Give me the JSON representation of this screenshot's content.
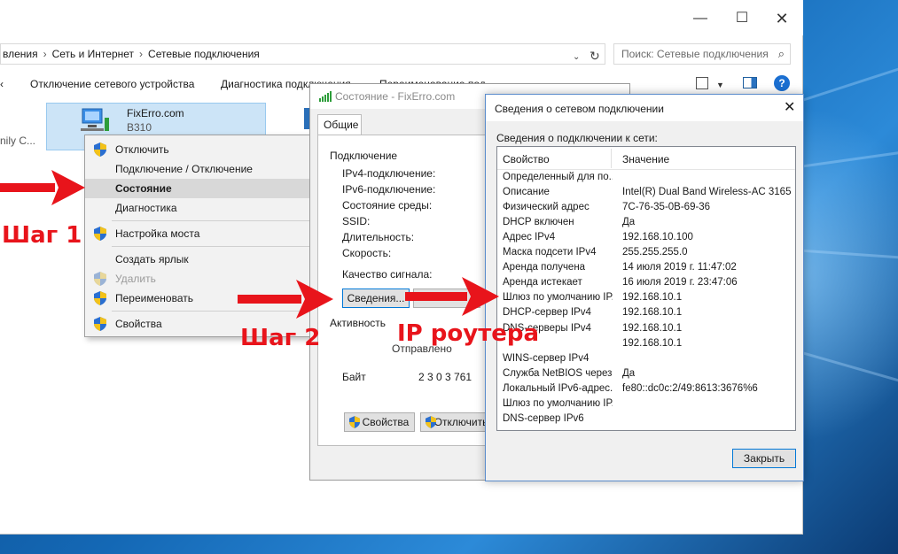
{
  "explorer": {
    "breadcrumb": [
      "вления",
      "Сеть и Интернет",
      "Сетевые подключения"
    ],
    "search_placeholder": "Поиск: Сетевые подключения",
    "commands": [
      "Отключение сетевого устройства",
      "Диагностика подключения",
      "Переименование подключения"
    ],
    "left_cut_text": "nily C...",
    "connection": {
      "name": "FixErro.com",
      "sub": "B310"
    }
  },
  "context_menu": {
    "items": [
      {
        "label": "Отключить",
        "shield": true
      },
      {
        "label": "Подключение / Отключение",
        "shield": false
      },
      {
        "label": "Состояние",
        "shield": false,
        "highlighted": true
      },
      {
        "label": "Диагностика",
        "shield": false
      },
      {
        "label": "Настройка моста",
        "shield": true
      },
      {
        "label": "Создать ярлык",
        "shield": false
      },
      {
        "label": "Удалить",
        "shield": true,
        "disabled": true
      },
      {
        "label": "Переименовать",
        "shield": true
      },
      {
        "label": "Свойства",
        "shield": true
      }
    ]
  },
  "annotations": {
    "step1": "Шаг 1",
    "step2": "Шаг 2",
    "router_ip": "IP роутера",
    "color": "#e8141b"
  },
  "status_dialog": {
    "title": "Состояние - FixErro.com",
    "tab": "Общие",
    "section_connection": "Подключение",
    "rows": [
      "IPv4-подключение:",
      "IPv6-подключение:",
      "Состояние среды:",
      "SSID:",
      "Длительность:",
      "Скорость:"
    ],
    "signal_quality": "Качество сигнала:",
    "details_button": "Сведения...",
    "section_activity": "Активность",
    "sent_label": "Отправлено",
    "bytes_label": "Байт",
    "bytes_value": "2 3 0 3 761",
    "properties_button": "Свойства",
    "disable_button": "Отключить"
  },
  "details_dialog": {
    "title": "Сведения о сетевом подключении",
    "subtitle": "Сведения о подключении к сети:",
    "col_property": "Свойство",
    "col_value": "Значение",
    "rows": [
      {
        "prop": "Определенный для по...",
        "val": ""
      },
      {
        "prop": "Описание",
        "val": "Intel(R) Dual Band Wireless-AC 3165"
      },
      {
        "prop": "Физический адрес",
        "val": "7C-76-35-0B-69-36"
      },
      {
        "prop": "DHCP включен",
        "val": "Да"
      },
      {
        "prop": "Адрес IPv4",
        "val": "192.168.10.100"
      },
      {
        "prop": "Маска подсети IPv4",
        "val": "255.255.255.0"
      },
      {
        "prop": "Аренда получена",
        "val": "14 июля 2019 г. 11:47:02"
      },
      {
        "prop": "Аренда истекает",
        "val": "16 июля 2019 г. 23:47:06"
      },
      {
        "prop": "Шлюз по умолчанию IP...",
        "val": "192.168.10.1"
      },
      {
        "prop": "DHCP-сервер IPv4",
        "val": "192.168.10.1"
      },
      {
        "prop": "DNS-серверы IPv4",
        "val": "192.168.10.1"
      },
      {
        "prop": "",
        "val": "192.168.10.1"
      },
      {
        "prop": "WINS-сервер IPv4",
        "val": ""
      },
      {
        "prop": "Служба NetBIOS через...",
        "val": "Да"
      },
      {
        "prop": "Локальный IPv6-адрес...",
        "val": "fe80::dc0c:2/49:8613:3676%6"
      },
      {
        "prop": "Шлюз по умолчанию IP...",
        "val": ""
      },
      {
        "prop": "DNS-сервер IPv6",
        "val": ""
      }
    ],
    "close_button": "Закрыть"
  }
}
